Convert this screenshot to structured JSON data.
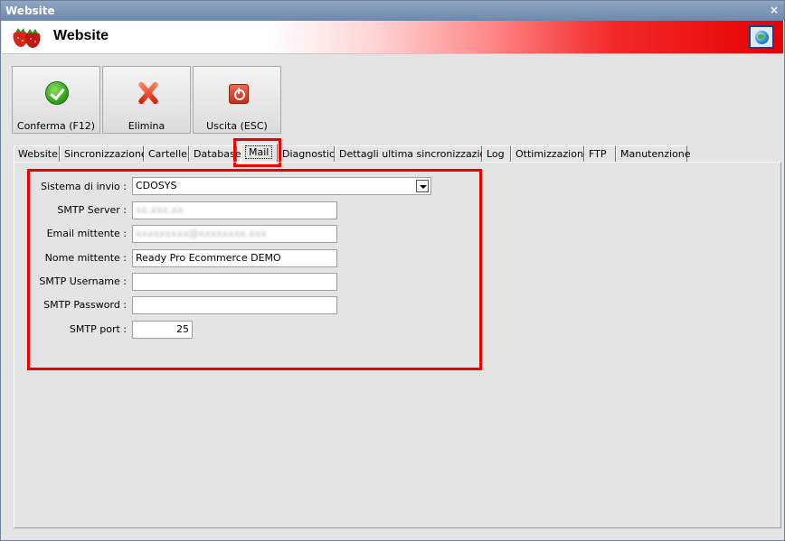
{
  "window": {
    "title": "Website",
    "close_label": "×"
  },
  "header": {
    "title": "Website",
    "logo_icon": "strawberry-logo",
    "globe_icon": "globe-icon",
    "accent_color": "#e60000"
  },
  "toolbar": {
    "buttons": [
      {
        "label": "Conferma (F12)",
        "icon": "check-icon"
      },
      {
        "label": "Elimina",
        "icon": "delete-x-icon"
      },
      {
        "label": "Uscita (ESC)",
        "icon": "power-exit-icon"
      }
    ]
  },
  "tabs": [
    {
      "label": "Website"
    },
    {
      "label": "Sincronizzazione"
    },
    {
      "label": "Cartelle"
    },
    {
      "label": "Database"
    },
    {
      "label": "Mail",
      "active": true
    },
    {
      "label": "Diagnostica"
    },
    {
      "label": "Dettagli ultima sincronizzazione"
    },
    {
      "label": "Log"
    },
    {
      "label": "Ottimizzazione"
    },
    {
      "label": "FTP"
    },
    {
      "label": "Manutenzione"
    }
  ],
  "mail_form": {
    "sistema_invio": {
      "label": "Sistema di invio :",
      "value": "CDOSYS"
    },
    "smtp_server": {
      "label": "SMTP Server :",
      "value": "xx.xxx.xx"
    },
    "email_mittente": {
      "label": "Email mittente :",
      "value": "xxxxxxxxx@xxxxxxxx.xxx"
    },
    "nome_mittente": {
      "label": "Nome mittente :",
      "value": "Ready Pro Ecommerce DEMO"
    },
    "smtp_username": {
      "label": "SMTP Username :",
      "value": ""
    },
    "smtp_password": {
      "label": "SMTP Password :",
      "value": ""
    },
    "smtp_port": {
      "label": "SMTP port :",
      "value": "25"
    }
  }
}
